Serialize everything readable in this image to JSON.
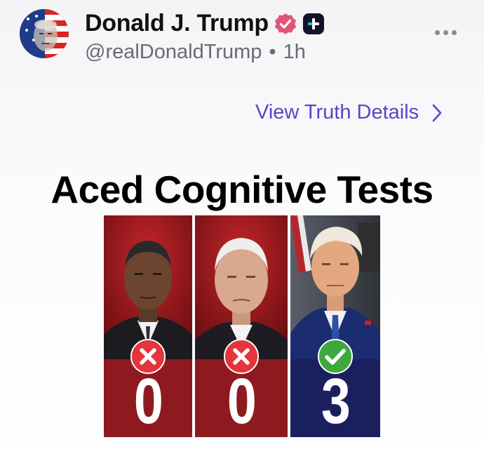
{
  "post": {
    "author_name": "Donald J. Trump",
    "handle": "@realDonaldTrump",
    "separator": "•",
    "time": "1h",
    "details_link": "View Truth Details",
    "image_title": "Aced Cognitive Tests"
  },
  "panels": [
    {
      "score": "0",
      "mark": "x-icon",
      "color": "#8e1a1f"
    },
    {
      "score": "0",
      "mark": "x-icon",
      "color": "#8e1a1f"
    },
    {
      "score": "3",
      "mark": "check-icon",
      "color": "#1a1f5e"
    }
  ],
  "colors": {
    "accent": "#5448c8",
    "verified": "#e0567b",
    "x_mark": "#e5343b",
    "check_mark": "#3fa83c"
  }
}
